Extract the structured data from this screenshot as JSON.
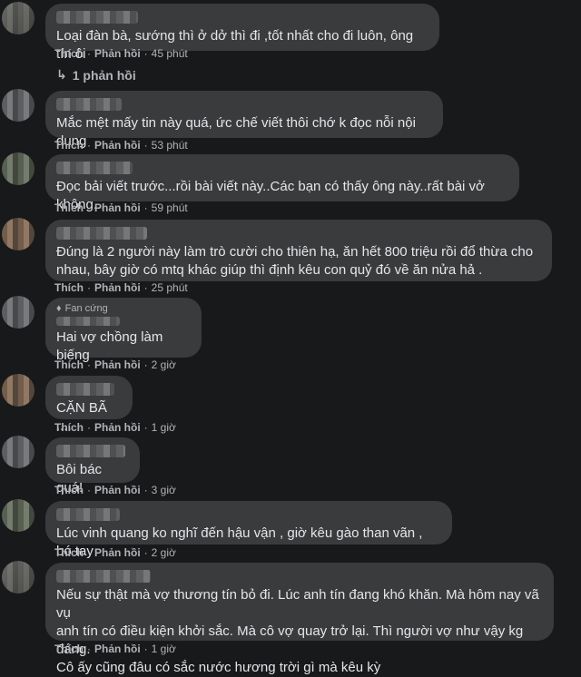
{
  "comments": [
    {
      "text": "Loại đàn bà, sướng thì ở dở thì đi ,tốt nhất cho đi luôn, ông tín ôi",
      "like": "Thích",
      "reply": "Phản hồi",
      "time": "45 phút"
    },
    {
      "text": "Mắc mệt mấy tin này quá, ức chế viết thôi chớ k đọc nỗi nội dung",
      "like": "Thích",
      "reply": "Phản hồi",
      "time": "53 phút"
    },
    {
      "text": "Đọc bải viết trước...rồi bài viết này..Các bạn có thấy ông này..rất bài vở không...",
      "like": "Thích",
      "reply": "Phản hồi",
      "time": "59 phút"
    },
    {
      "text": "Đúng là 2 người này làm trò cười cho thiên hạ, ăn hết 800 triệu rồi đổ thừa cho\nnhau, bây giờ có mtq khác giúp thì định kêu con quỷ đó về ăn nửa hả .",
      "like": "Thích",
      "reply": "Phản hồi",
      "time": "25 phút"
    },
    {
      "badge": "Fan cứng",
      "text": "Hai vợ chồng làm biếng",
      "like": "Thích",
      "reply": "Phản hồi",
      "time": "2 giờ"
    },
    {
      "text": "CẶN BÃ ....",
      "like": "Thích",
      "reply": "Phản hồi",
      "time": "1 giờ"
    },
    {
      "text": "Bôi bác quá!",
      "like": "Thích",
      "reply": "Phản hồi",
      "time": "3 giờ"
    },
    {
      "text": "Lúc vinh quang ko nghĩ đến hậu vận , giờ kêu gào than vãn , bó tay",
      "like": "Thích",
      "reply": "Phản hồi",
      "time": "2 giờ"
    },
    {
      "text": "Nếu sự thật mà vợ thương tín bỏ đi. Lúc anh tín đang khó khăn. Mà hôm nay vã vụ\nanh tín có điều kiện khởi sắc. Mà cô vợ quay trở lại. Thì người vợ như vậy kg đáng.\nCô ấy cũng đâu có sắc nước hương trời gì mà kêu kỳ",
      "like": "Thích",
      "reply": "Phản hồi",
      "time": "1 giờ"
    }
  ],
  "replies_link": {
    "icon": "reply-arrow-icon",
    "label": "1 phản hồi"
  }
}
